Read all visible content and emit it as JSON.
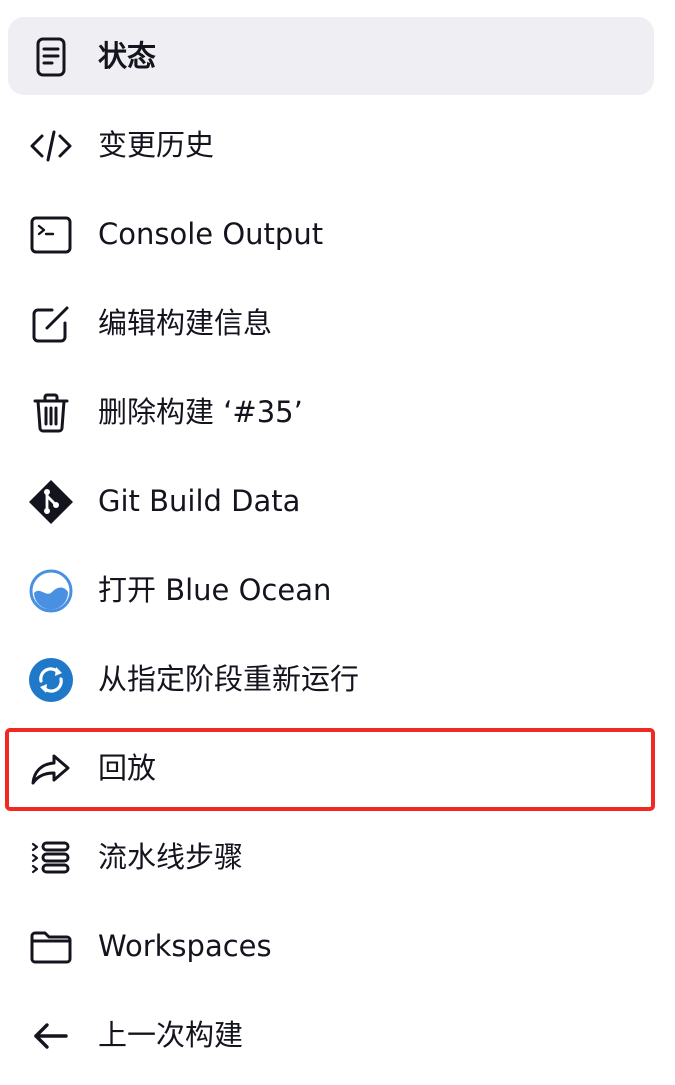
{
  "menu": {
    "items": [
      {
        "label": "状态",
        "icon": "status-document-icon",
        "active": true
      },
      {
        "label": "变更历史",
        "icon": "code-brackets-icon"
      },
      {
        "label": "Console Output",
        "icon": "terminal-icon"
      },
      {
        "label": "编辑构建信息",
        "icon": "edit-icon"
      },
      {
        "label": "删除构建 ‘#35’",
        "icon": "trash-icon"
      },
      {
        "label": "Git Build Data",
        "icon": "git-icon"
      },
      {
        "label": "打开 Blue Ocean",
        "icon": "blue-ocean-icon"
      },
      {
        "label": "从指定阶段重新运行",
        "icon": "restart-stage-icon"
      },
      {
        "label": "回放",
        "icon": "replay-icon",
        "highlighted": true
      },
      {
        "label": "流水线步骤",
        "icon": "pipeline-steps-icon"
      },
      {
        "label": "Workspaces",
        "icon": "folder-icon"
      },
      {
        "label": "上一次构建",
        "icon": "arrow-left-icon"
      }
    ]
  },
  "colors": {
    "active_bg": "#efeff3",
    "highlight_border": "#f02a22",
    "text": "#14141f",
    "blue_ocean": "#4a90e2",
    "restart_blue": "#1f78c8"
  }
}
